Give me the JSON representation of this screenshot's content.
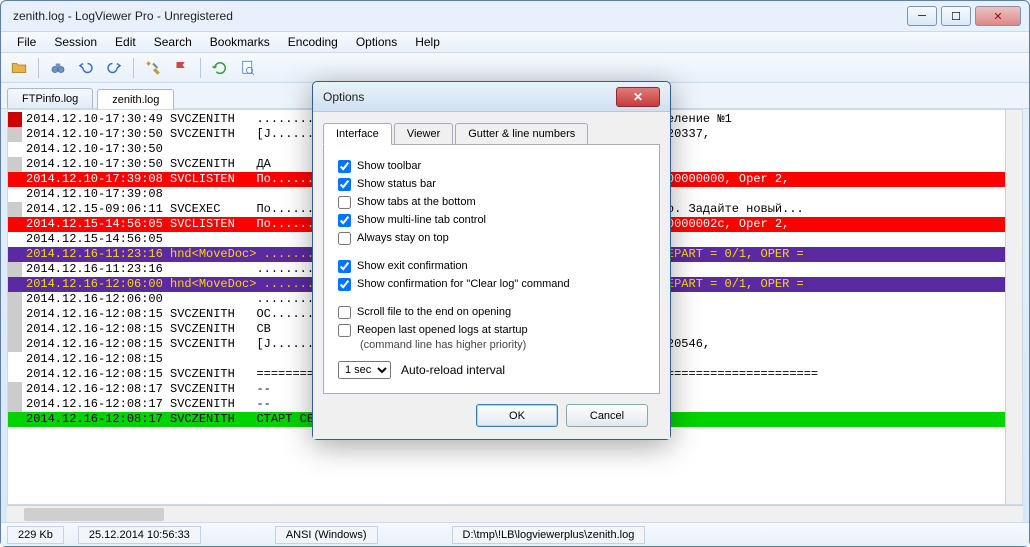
{
  "window": {
    "title": "zenith.log - LogViewer Pro - Unregistered"
  },
  "menu": [
    "File",
    "Session",
    "Edit",
    "Search",
    "Bookmarks",
    "Encoding",
    "Options",
    "Help"
  ],
  "filetabs": [
    {
      "label": "FTPinfo.log",
      "active": false
    },
    {
      "label": "zenith.log",
      "active": true
    }
  ],
  "log": [
    {
      "gutter": "red",
      "style": "",
      "text": "2014.12.10-17:30:49 SVCZENITH   ...................................... 020060001. Подразделение №1"
    },
    {
      "gutter": "gray",
      "style": "",
      "text": "2014.12.10-17:30:50 SVCZENITH   [J...................................., JIPK=17312, JOPK=20337,"
    },
    {
      "gutter": "none",
      "style": "",
      "text": "2014.12.10-17:30:50"
    },
    {
      "gutter": "gray",
      "style": "",
      "text": "2014.12.10-17:30:50 SVCZENITH   ДА"
    },
    {
      "gutter": "none",
      "style": "hl-red",
      "text": "2014.12.10-17:39:08 SVCLISTEN   По.................................... Code 109, Session 00000000, Oper 2,"
    },
    {
      "gutter": "none",
      "style": "",
      "text": "2014.12.10-17:39:08"
    },
    {
      "gutter": "gray",
      "style": "",
      "text": "2014.12.15-09:06:11 SVCEXEC     По....................................ствия пароля истекло. Задайте новый..."
    },
    {
      "gutter": "none",
      "style": "hl-red",
      "text": "2014.12.15-14:56:05 SVCLISTEN   По.................................... Code 109, Session 0000002c, Oper 2,"
    },
    {
      "gutter": "none",
      "style": "",
      "text": "2014.12.15-14:56:05"
    },
    {
      "gutter": "none",
      "style": "hl-purple",
      "text": "2014.12.16-11:23:16 hnd<MoveDoc> .......................................O_SUBDIV = 1/1, DEPART = 0/1, OPER ="
    },
    {
      "gutter": "gray",
      "style": "",
      "text": "2014.12.16-11:23:16             ......................................D=32751, # 14Б858"
    },
    {
      "gutter": "none",
      "style": "hl-purple",
      "text": "2014.12.16-12:06:00 hnd<MoveDoc> .......................................O_SUBDIV = 1/1, DEPART = 0/1, OPER ="
    },
    {
      "gutter": "gray",
      "style": "",
      "text": "2014.12.16-12:06:00             ......................................D=32886, # 14Б874"
    },
    {
      "gutter": "gray",
      "style": "",
      "text": "2014.12.16-12:08:15 SVCZENITH   ОС....................................-----"
    },
    {
      "gutter": "gray",
      "style": "",
      "text": "2014.12.16-12:08:15 SVCZENITH   СВ"
    },
    {
      "gutter": "gray",
      "style": "",
      "text": "2014.12.16-12:08:15 SVCZENITH   [J...................................., JIPK=17464, JOPK=20546,"
    },
    {
      "gutter": "none",
      "style": "",
      "text": "2014.12.16-12:08:15"
    },
    {
      "gutter": "none",
      "style": "",
      "text": "2014.12.16-12:08:15 SVCZENITH   =============================================================================="
    },
    {
      "gutter": "gray",
      "style": "",
      "text": "2014.12.16-12:08:17 SVCZENITH   --"
    },
    {
      "gutter": "gray",
      "style": "",
      "text": "2014.12.16-12:08:17 SVCZENITH   --"
    },
    {
      "gutter": "none",
      "style": "hl-green",
      "text": "2014.12.16-12:08:17 SVCZENITH   СТАРТ СЕРВЕРА"
    }
  ],
  "status": {
    "size": "229 Kb",
    "date": "25.12.2014 10:56:33",
    "encoding": "ANSI (Windows)",
    "path": "D:\\tmp\\!LB\\logviewerplus\\zenith.log"
  },
  "dialog": {
    "title": "Options",
    "tabs": [
      "Interface",
      "Viewer",
      "Gutter & line numbers"
    ],
    "active_tab": 0,
    "checks": {
      "show_toolbar": {
        "label": "Show toolbar",
        "checked": true
      },
      "show_statusbar": {
        "label": "Show status bar",
        "checked": true
      },
      "tabs_bottom": {
        "label": "Show tabs at the bottom",
        "checked": false
      },
      "multiline_tab": {
        "label": "Show multi-line tab control",
        "checked": true
      },
      "stay_on_top": {
        "label": "Always stay on top",
        "checked": false
      },
      "exit_confirm": {
        "label": "Show exit confirmation",
        "checked": true
      },
      "clear_confirm": {
        "label": "Show confirmation for \"Clear log\" command",
        "checked": true
      },
      "scroll_end": {
        "label": "Scroll file to the end on opening",
        "checked": false
      },
      "reopen_last": {
        "label": "Reopen last opened logs at startup",
        "checked": false
      }
    },
    "reopen_hint": "(command line has higher priority)",
    "reload_interval": "1 sec",
    "reload_label": "Auto-reload interval",
    "ok": "OK",
    "cancel": "Cancel"
  }
}
